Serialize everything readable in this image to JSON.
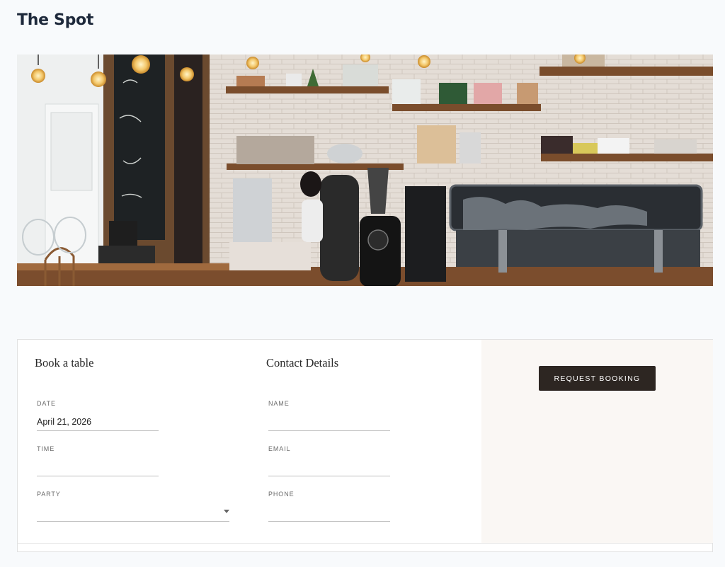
{
  "page": {
    "title": "The Spot"
  },
  "hero": {
    "image_alt": "cafe-counter-photo"
  },
  "booking": {
    "heading": "Book a table",
    "fields": {
      "date": {
        "label": "DATE",
        "value": "April 21, 2026"
      },
      "time": {
        "label": "TIME",
        "value": ""
      },
      "party": {
        "label": "PARTY",
        "value": ""
      }
    }
  },
  "contact": {
    "heading": "Contact Details",
    "fields": {
      "name": {
        "label": "NAME",
        "value": ""
      },
      "email": {
        "label": "EMAIL",
        "value": ""
      },
      "phone": {
        "label": "PHONE",
        "value": ""
      }
    }
  },
  "actions": {
    "request_label": "REQUEST BOOKING"
  },
  "colors": {
    "background": "#f8fafc",
    "button": "#2d2622",
    "side_panel": "#faf7f4"
  },
  "icons": {
    "party_select": "chevron-down-icon"
  }
}
